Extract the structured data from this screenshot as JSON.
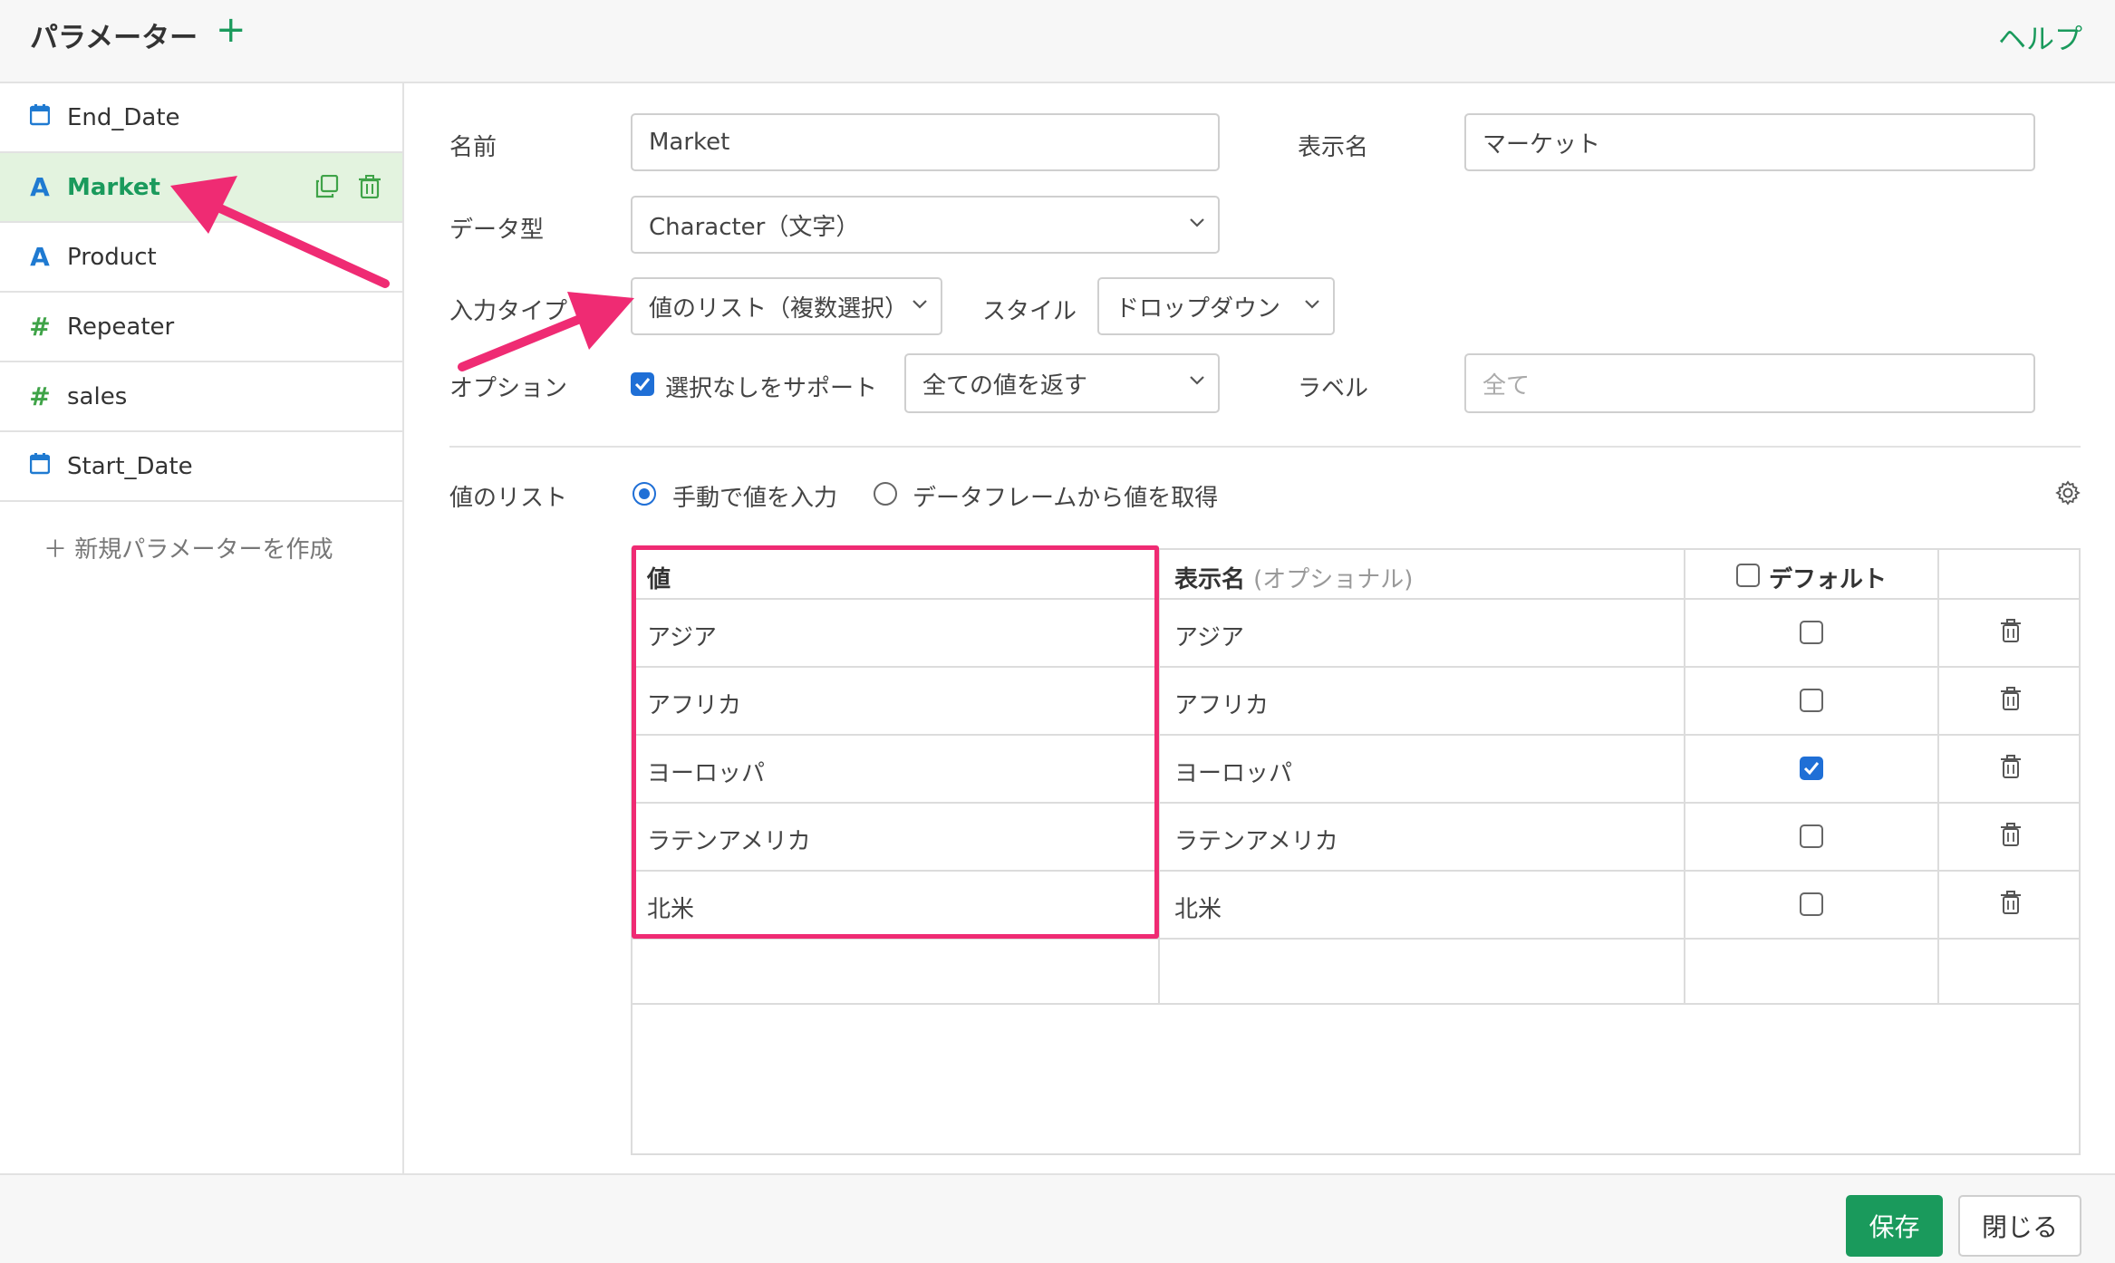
{
  "header": {
    "title": "パラメーター",
    "add_label": "+",
    "help_label": "ヘルプ"
  },
  "sidebar": {
    "items": [
      {
        "icon": "calendar-icon",
        "label": "End_Date"
      },
      {
        "icon": "text-type-icon",
        "label": "Market",
        "active": true
      },
      {
        "icon": "text-type-icon",
        "label": "Product"
      },
      {
        "icon": "number-type-icon",
        "label": "Repeater"
      },
      {
        "icon": "number-type-icon",
        "label": "sales"
      },
      {
        "icon": "calendar-icon",
        "label": "Start_Date"
      }
    ],
    "new_param_label": "＋ 新規パラメーターを作成"
  },
  "form": {
    "name_label": "名前",
    "name_value": "Market",
    "display_name_label": "表示名",
    "display_name_value": "マーケット",
    "data_type_label": "データ型",
    "data_type_value": "Character（文字）",
    "input_type_label": "入力タイプ",
    "input_type_value": "値のリスト（複数選択）",
    "style_label": "スタイル",
    "style_value": "ドロップダウン",
    "option_label": "オプション",
    "support_none_label": "選択なしをサポート",
    "support_none_checked": true,
    "return_value": "全ての値を返す",
    "label_label": "ラベル",
    "label_placeholder": "全て"
  },
  "value_list": {
    "label": "値のリスト",
    "radio_manual": "手動で値を入力",
    "radio_dataframe": "データフレームから値を取得",
    "selected": "manual"
  },
  "table": {
    "col_value": "値",
    "col_display": "表示名",
    "col_display_optional": "(オプショナル)",
    "col_default": "デフォルト",
    "rows": [
      {
        "value": "アジア",
        "display": "アジア",
        "default": false
      },
      {
        "value": "アフリカ",
        "display": "アフリカ",
        "default": false
      },
      {
        "value": "ヨーロッパ",
        "display": "ヨーロッパ",
        "default": true
      },
      {
        "value": "ラテンアメリカ",
        "display": "ラテンアメリカ",
        "default": false
      },
      {
        "value": "北米",
        "display": "北米",
        "default": false
      }
    ]
  },
  "footer": {
    "save_label": "保存",
    "close_label": "閉じる"
  },
  "colors": {
    "accent_green": "#1a9a5c",
    "highlight_pink": "#ef2b73",
    "check_blue": "#1f6fd6"
  }
}
